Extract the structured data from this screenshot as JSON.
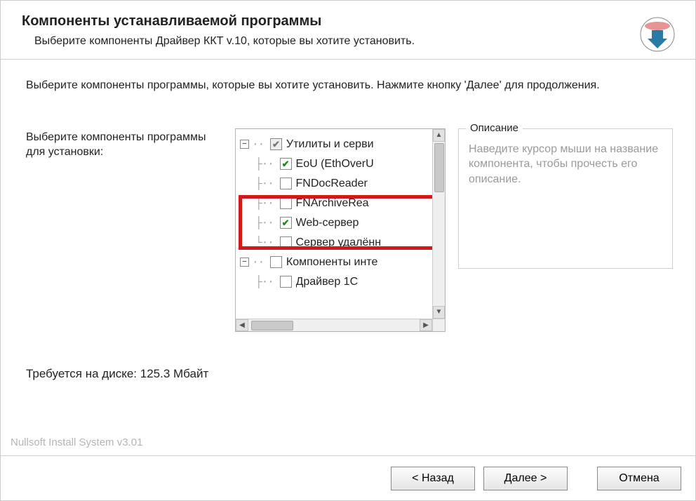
{
  "header": {
    "title": "Компоненты устанавливаемой программы",
    "subtitle": "Выберите компоненты Драйвер ККТ v.10, которые вы хотите установить."
  },
  "instructions": "Выберите компоненты программы, которые вы хотите установить. Нажмите кнопку 'Далее' для продолжения.",
  "left_label": "Выберите компоненты программы для установки:",
  "tree": {
    "group1": {
      "label": "Утилиты и серви",
      "state": "partial"
    },
    "items1": [
      {
        "label": "EoU (EthOverU",
        "state": "checked"
      },
      {
        "label": "FNDocReader",
        "state": "unchecked"
      },
      {
        "label": "FNArchiveRea",
        "state": "unchecked"
      },
      {
        "label": "Web-сервер",
        "state": "checked"
      },
      {
        "label": "Сервер удалённ",
        "state": "unchecked"
      }
    ],
    "group2": {
      "label": "Компоненты инте",
      "state": "unchecked"
    },
    "items2": [
      {
        "label": "Драйвер 1C",
        "state": "unchecked"
      }
    ]
  },
  "description": {
    "legend": "Описание",
    "text": "Наведите курсор мыши на название компонента, чтобы прочесть его описание."
  },
  "disk": "Требуется на диске: 125.3 Мбайт",
  "installer": "Nullsoft Install System v3.01",
  "buttons": {
    "back": "< Назад",
    "next": "Далее >",
    "cancel": "Отмена"
  }
}
